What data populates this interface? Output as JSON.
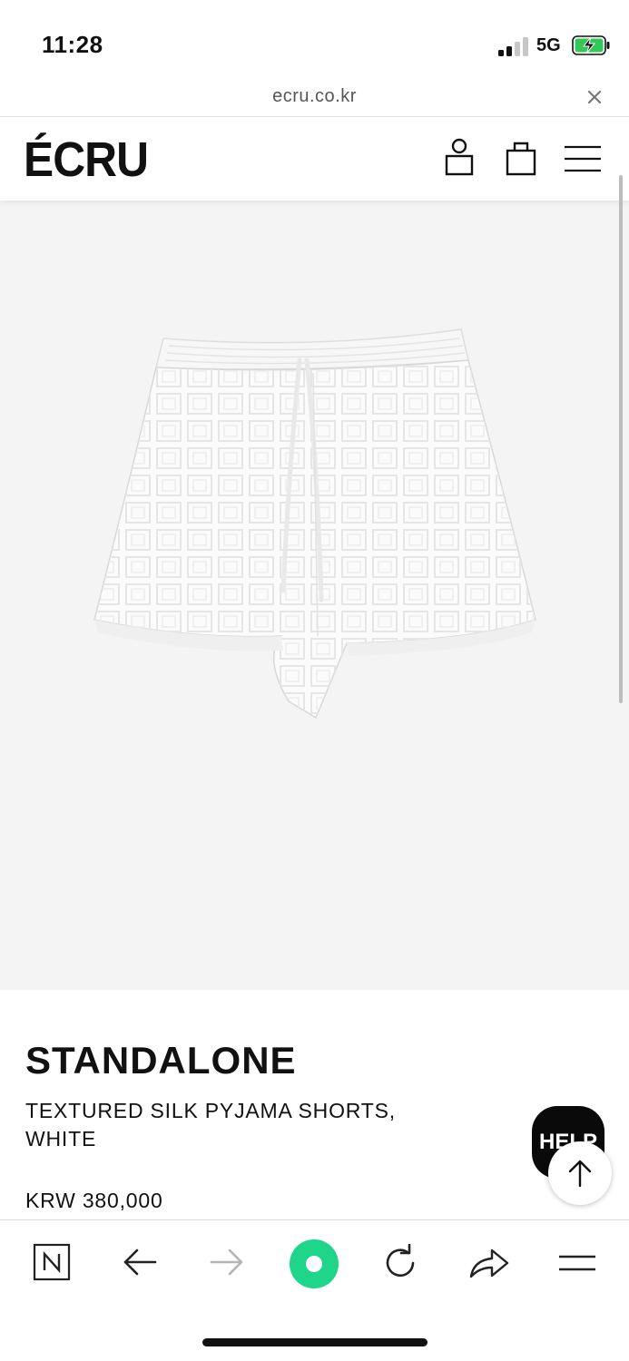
{
  "status_bar": {
    "time": "11:28",
    "network": "5G"
  },
  "browser": {
    "url": "ecru.co.kr"
  },
  "header": {
    "logo": "ÉCRU"
  },
  "product": {
    "brand": "STANDALONE",
    "name": "TEXTURED SILK PYJAMA SHORTS, WHITE",
    "price": "KRW 380,000",
    "image_alt": "white textured silk pyjama shorts"
  },
  "floating": {
    "help_label": "HELP"
  },
  "colors": {
    "image_bg": "#f4f4f4",
    "accent_green": "#1fd58a",
    "battery_green": "#34c759"
  }
}
